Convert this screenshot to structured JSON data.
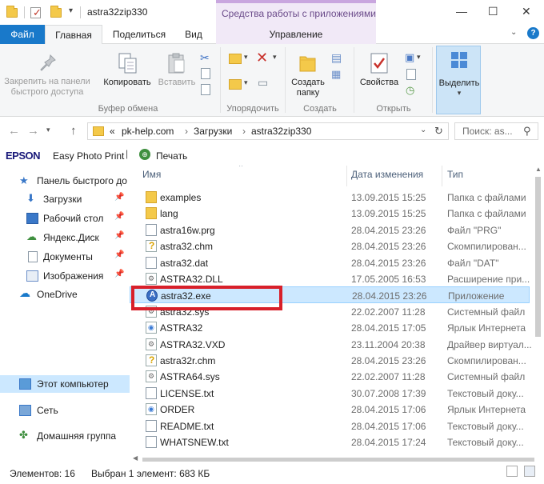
{
  "window": {
    "title": "astra32zip330",
    "tools_header": "Средства работы с приложениями",
    "minimize": "—",
    "maximize": "☐",
    "close": "✕",
    "help": "?"
  },
  "tabs": [
    {
      "label": "Файл"
    },
    {
      "label": "Главная"
    },
    {
      "label": "Поделиться"
    },
    {
      "label": "Вид"
    },
    {
      "label": "Управление"
    }
  ],
  "ribbon": {
    "pin_label": "Закрепить на панели быстрого доступа",
    "pin_line1": "Закрепить на панели",
    "pin_line2": "быстрого доступа",
    "copy_label": "Копировать",
    "paste_label": "Вставить",
    "new_folder_line1": "Создать",
    "new_folder_line2": "папку",
    "properties_label": "Свойства",
    "select_label": "Выделить",
    "groups": {
      "clipboard": "Буфер обмена",
      "organize": "Упорядочить",
      "new": "Создать",
      "open": "Открыть"
    }
  },
  "address": {
    "prefix": "«",
    "crumbs": [
      "pk-help.com",
      "Загрузки",
      "astra32zip330"
    ],
    "separator": "›",
    "search_placeholder": "Поиск: as..."
  },
  "epson": {
    "logo": "EPSON",
    "app": "Easy Photo Print",
    "print": "Печать"
  },
  "nav": {
    "quick_access": "Панель быстрого до",
    "downloads": "Загрузки",
    "desktop": "Рабочий стол",
    "yandex": "Яндекс.Диск",
    "documents": "Документы",
    "pictures": "Изображения",
    "onedrive": "OneDrive",
    "this_pc": "Этот компьютер",
    "network": "Сеть",
    "homegroup": "Домашняя группа"
  },
  "columns": {
    "name": "Имя",
    "date": "Дата изменения",
    "type": "Тип"
  },
  "files": [
    {
      "name": "examples",
      "date": "13.09.2015 15:25",
      "type": "Папка с файлами",
      "icon": "folder"
    },
    {
      "name": "lang",
      "date": "13.09.2015 15:25",
      "type": "Папка с файлами",
      "icon": "folder"
    },
    {
      "name": "astra16w.prg",
      "date": "28.04.2015 23:26",
      "type": "Файл \"PRG\"",
      "icon": "generic"
    },
    {
      "name": "astra32.chm",
      "date": "28.04.2015 23:26",
      "type": "Скомпилирован...",
      "icon": "help"
    },
    {
      "name": "astra32.dat",
      "date": "28.04.2015 23:26",
      "type": "Файл \"DAT\"",
      "icon": "generic"
    },
    {
      "name": "ASTRA32.DLL",
      "date": "17.05.2005 16:53",
      "type": "Расширение при...",
      "icon": "system"
    },
    {
      "name": "astra32.exe",
      "date": "28.04.2015 23:26",
      "type": "Приложение",
      "icon": "exe"
    },
    {
      "name": "astra32.sys",
      "date": "22.02.2007 11:28",
      "type": "Системный файл",
      "icon": "system"
    },
    {
      "name": "ASTRA32",
      "date": "28.04.2015 17:05",
      "type": "Ярлык Интернета",
      "icon": "url"
    },
    {
      "name": "ASTRA32.VXD",
      "date": "23.11.2004 20:38",
      "type": "Драйвер виртуал...",
      "icon": "system"
    },
    {
      "name": "astra32r.chm",
      "date": "28.04.2015 23:26",
      "type": "Скомпилирован...",
      "icon": "help"
    },
    {
      "name": "ASTRA64.sys",
      "date": "22.02.2007 11:28",
      "type": "Системный файл",
      "icon": "system"
    },
    {
      "name": "LICENSE.txt",
      "date": "30.07.2008 17:39",
      "type": "Текстовый доку...",
      "icon": "generic"
    },
    {
      "name": "ORDER",
      "date": "28.04.2015 17:06",
      "type": "Ярлык Интернета",
      "icon": "url"
    },
    {
      "name": "README.txt",
      "date": "28.04.2015 17:06",
      "type": "Текстовый доку...",
      "icon": "generic"
    },
    {
      "name": "WHATSNEW.txt",
      "date": "28.04.2015 17:24",
      "type": "Текстовый доку...",
      "icon": "generic"
    }
  ],
  "status": {
    "count": "Элементов: 16",
    "selected": "Выбран 1 элемент: 683 КБ"
  },
  "accent": "#1979ca",
  "highlight_color": "#d8202a"
}
